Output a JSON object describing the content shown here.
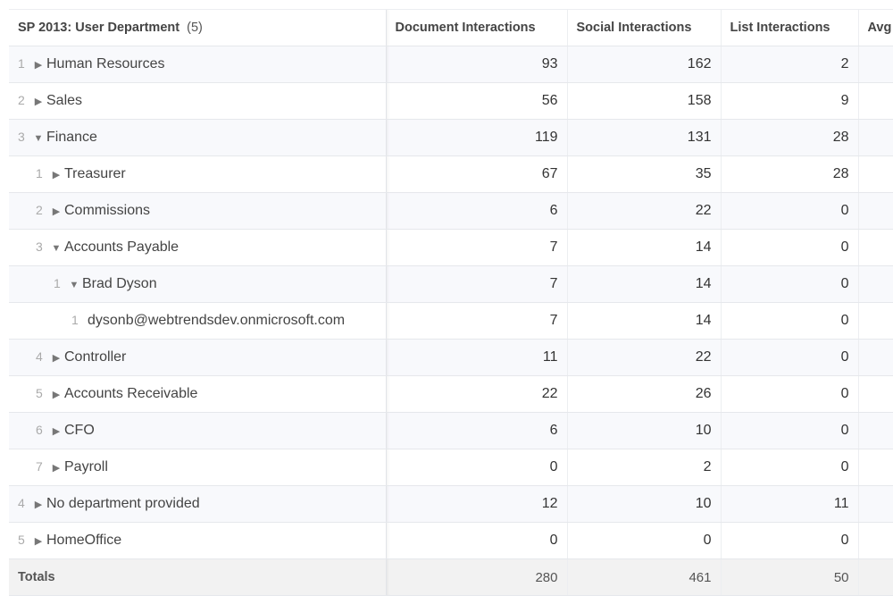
{
  "table": {
    "header": {
      "title": "SP 2013: User Department",
      "count": "(5)"
    },
    "columns": [
      "Document Interactions",
      "Social Interactions",
      "List Interactions",
      "Avg"
    ],
    "rows": [
      {
        "index": "1",
        "level": 0,
        "state": "collapsed",
        "label": "Human Resources",
        "values": [
          "93",
          "162",
          "2"
        ]
      },
      {
        "index": "2",
        "level": 0,
        "state": "collapsed",
        "label": "Sales",
        "values": [
          "56",
          "158",
          "9"
        ]
      },
      {
        "index": "3",
        "level": 0,
        "state": "expanded",
        "label": "Finance",
        "values": [
          "119",
          "131",
          "28"
        ]
      },
      {
        "index": "1",
        "level": 1,
        "state": "collapsed",
        "label": "Treasurer",
        "values": [
          "67",
          "35",
          "28"
        ]
      },
      {
        "index": "2",
        "level": 1,
        "state": "collapsed",
        "label": "Commissions",
        "values": [
          "6",
          "22",
          "0"
        ]
      },
      {
        "index": "3",
        "level": 1,
        "state": "expanded",
        "label": "Accounts Payable",
        "values": [
          "7",
          "14",
          "0"
        ]
      },
      {
        "index": "1",
        "level": 2,
        "state": "expanded",
        "label": "Brad Dyson",
        "values": [
          "7",
          "14",
          "0"
        ]
      },
      {
        "index": "1",
        "level": 3,
        "state": "leaf",
        "label": "dysonb@webtrendsdev.onmicrosoft.com",
        "values": [
          "7",
          "14",
          "0"
        ]
      },
      {
        "index": "4",
        "level": 1,
        "state": "collapsed",
        "label": "Controller",
        "values": [
          "11",
          "22",
          "0"
        ]
      },
      {
        "index": "5",
        "level": 1,
        "state": "collapsed",
        "label": "Accounts Receivable",
        "values": [
          "22",
          "26",
          "0"
        ]
      },
      {
        "index": "6",
        "level": 1,
        "state": "collapsed",
        "label": "CFO",
        "values": [
          "6",
          "10",
          "0"
        ]
      },
      {
        "index": "7",
        "level": 1,
        "state": "collapsed",
        "label": "Payroll",
        "values": [
          "0",
          "2",
          "0"
        ]
      },
      {
        "index": "4",
        "level": 0,
        "state": "collapsed",
        "label": "No department provided",
        "values": [
          "12",
          "10",
          "11"
        ]
      },
      {
        "index": "5",
        "level": 0,
        "state": "collapsed",
        "label": "HomeOffice",
        "values": [
          "0",
          "0",
          "0"
        ]
      }
    ],
    "totals": {
      "label": "Totals",
      "values": [
        "280",
        "461",
        "50"
      ]
    }
  },
  "icons": {
    "collapsed": "caret-right-icon",
    "expanded": "caret-down-icon"
  }
}
